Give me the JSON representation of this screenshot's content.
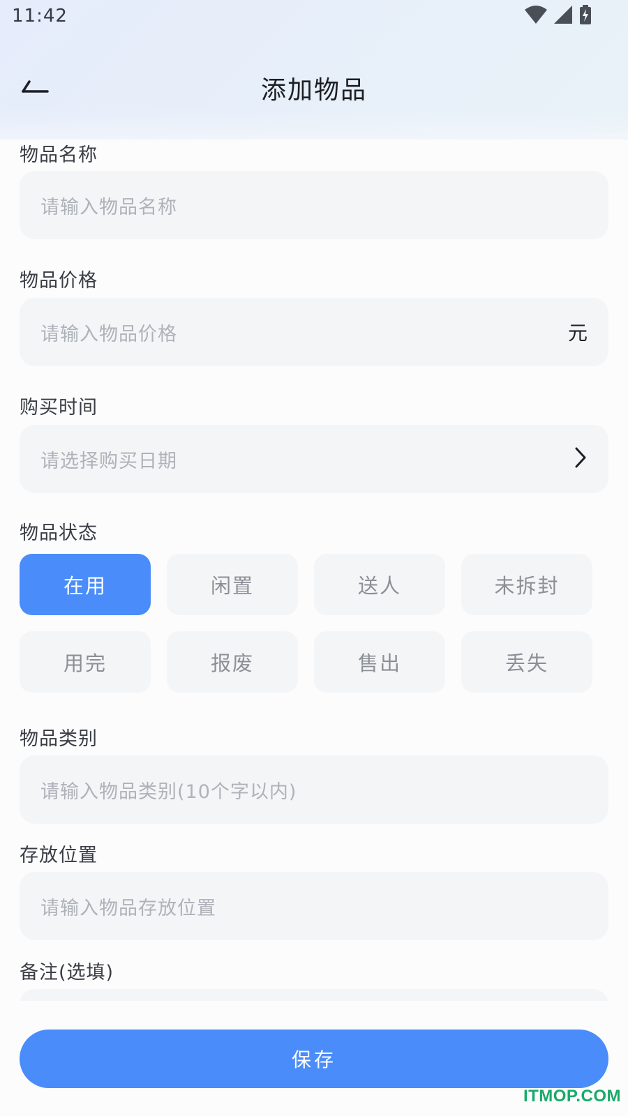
{
  "status_bar": {
    "time": "11:42"
  },
  "header": {
    "title": "添加物品"
  },
  "form": {
    "name": {
      "label": "物品名称",
      "placeholder": "请输入物品名称"
    },
    "price": {
      "label": "物品价格",
      "placeholder": "请输入物品价格",
      "suffix": "元"
    },
    "purchase_time": {
      "label": "购买时间",
      "placeholder": "请选择购买日期"
    },
    "status": {
      "label": "物品状态",
      "options": [
        "在用",
        "闲置",
        "送人",
        "未拆封",
        "用完",
        "报废",
        "售出",
        "丢失"
      ],
      "selected": "在用"
    },
    "category": {
      "label": "物品类别",
      "placeholder": "请输入物品类别(10个字以内)"
    },
    "location": {
      "label": "存放位置",
      "placeholder": "请输入物品存放位置"
    },
    "note": {
      "label": "备注(选填)"
    }
  },
  "footer": {
    "save_label": "保存"
  },
  "watermark": "ITMOP.COM",
  "colors": {
    "accent": "#4a8cfa",
    "input_bg": "#f4f5f7",
    "placeholder": "#aeb2b9",
    "watermark": "#1aa96a"
  }
}
